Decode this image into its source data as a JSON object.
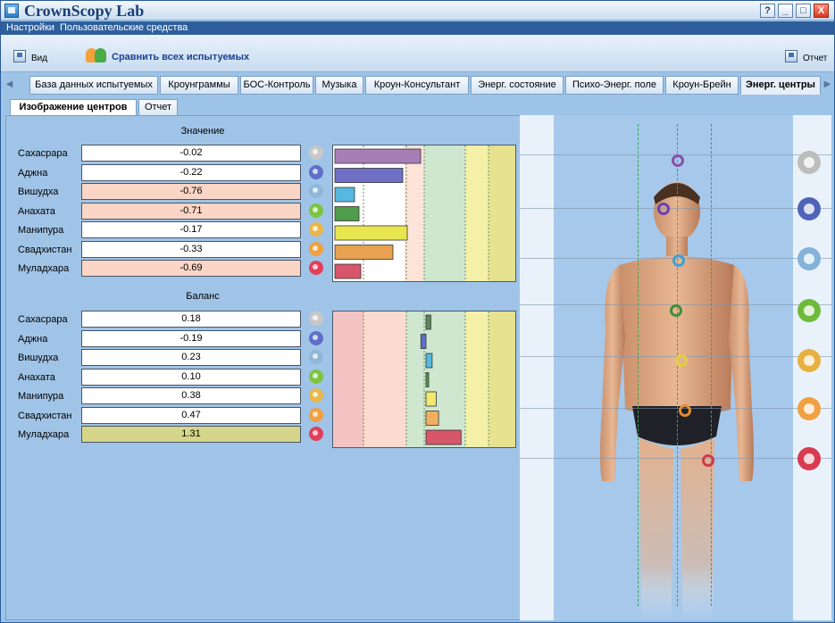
{
  "window": {
    "title": "CrownScopy Lab",
    "help": "?",
    "minimize": "_",
    "maximize": "□",
    "close": "X"
  },
  "menu": [
    "Настройки",
    "Пользовательские средства"
  ],
  "toolbar": {
    "view_label": "Вид",
    "compare_label": "Сравнить всех испытуемых",
    "report_label": "Отчет"
  },
  "tabs": [
    "База данных испытуемых",
    "Кроунграммы",
    "БОС-Контроль",
    "Музыка",
    "Кроун-Консультант",
    "Энерг. состояние",
    "Психо-Энерг. поле",
    "Кроун-Брейн",
    "Энерг. центры"
  ],
  "active_tab": "Энерг. центры",
  "subtabs": [
    "Изображение центров",
    "Отчет"
  ],
  "active_subtab": "Изображение центров",
  "value_section": {
    "title": "Значение",
    "rows": [
      {
        "label": "Сахасрара",
        "value": "-0.02",
        "num": -0.02,
        "bar_color": "#a67fb7",
        "chakra_color": "#c8c8c8",
        "highlight": false
      },
      {
        "label": "Аджна",
        "value": "-0.22",
        "num": -0.22,
        "bar_color": "#6f6fc6",
        "chakra_color": "#5f6fc8",
        "highlight": false
      },
      {
        "label": "Вишудха",
        "value": "-0.76",
        "num": -0.76,
        "bar_color": "#56b8e0",
        "chakra_color": "#8fb7d8",
        "highlight": true
      },
      {
        "label": "Анахата",
        "value": "-0.71",
        "num": -0.71,
        "bar_color": "#4f9c4a",
        "chakra_color": "#7cc441",
        "highlight": true
      },
      {
        "label": "Манипура",
        "value": "-0.17",
        "num": -0.17,
        "bar_color": "#e8e64e",
        "chakra_color": "#e8b64a",
        "highlight": false
      },
      {
        "label": "Свадхистан",
        "value": "-0.33",
        "num": -0.33,
        "bar_color": "#e8a150",
        "chakra_color": "#f0a040",
        "highlight": false
      },
      {
        "label": "Муладхара",
        "value": "-0.69",
        "num": -0.69,
        "bar_color": "#d8566a",
        "chakra_color": "#e0405a",
        "highlight": true
      }
    ]
  },
  "balance_section": {
    "title": "Баланс",
    "rows": [
      {
        "label": "Сахасрара",
        "value": "0.18",
        "num": 0.18,
        "bar_color": "#5a8a5a",
        "chakra_color": "#c8c8c8",
        "highlight": false
      },
      {
        "label": "Аджна",
        "value": "-0.19",
        "num": -0.19,
        "bar_color": "#5f6fc8",
        "chakra_color": "#5f6fc8",
        "highlight": false
      },
      {
        "label": "Вишудха",
        "value": "0.23",
        "num": 0.23,
        "bar_color": "#56b8e0",
        "chakra_color": "#8fb7d8",
        "highlight": false
      },
      {
        "label": "Анахата",
        "value": "0.10",
        "num": 0.1,
        "bar_color": "#4f9c4a",
        "chakra_color": "#7cc441",
        "highlight": false
      },
      {
        "label": "Манипура",
        "value": "0.38",
        "num": 0.38,
        "bar_color": "#f0e870",
        "chakra_color": "#e8b64a",
        "highlight": false
      },
      {
        "label": "Свадхистан",
        "value": "0.47",
        "num": 0.47,
        "bar_color": "#f0b060",
        "chakra_color": "#f0a040",
        "highlight": false
      },
      {
        "label": "Муладхара",
        "value": "1.31",
        "num": 1.31,
        "bar_color": "#d8566a",
        "chakra_color": "#e0405a",
        "highlight": true
      }
    ]
  },
  "colors": {
    "value_highlight": "#fbd5c5",
    "balance_highlight": "#d6d68a",
    "normal": "#ffffff"
  }
}
